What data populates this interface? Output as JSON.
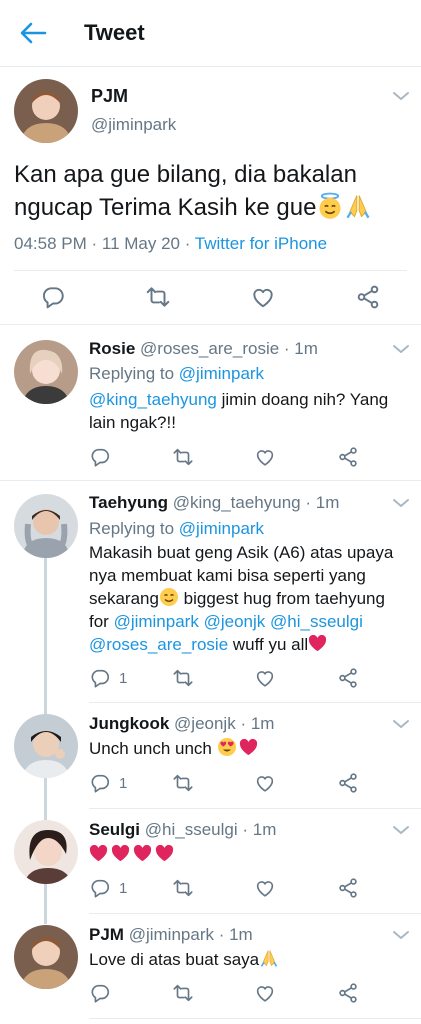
{
  "header": {
    "title": "Tweet"
  },
  "main": {
    "name": "PJM",
    "handle": "@jiminpark",
    "text": "Kan apa gue bilang, dia bakalan ngucap Terima Kasih ke gue",
    "time": "04:58 PM · 11 May 20 · ",
    "source": "Twitter for iPhone"
  },
  "replies": [
    {
      "name": "Rosie",
      "handle": "@roses_are_rosie",
      "time": "· 1m",
      "replying_label": "Replying to ",
      "replying_to": "@jiminpark",
      "mention": "@king_taehyung",
      "text": " jimin doang nih? Yang lain ngak?!!",
      "reply_count": ""
    },
    {
      "name": "Taehyung",
      "handle": "@king_taehyung",
      "time": "· 1m",
      "replying_label": "Replying to ",
      "replying_to": "@jiminpark",
      "text_a": "Makasih buat geng Asik (A6) atas upaya nya membuat kami bisa seperti yang sekarang",
      "text_b": " biggest hug from taehyung for ",
      "m1": "@jiminpark",
      "m2": "@jeonjk",
      "m3": "@hi_sseulgi",
      "m4": "@roses_are_rosie",
      "text_c": " wuff yu all",
      "reply_count": "1"
    },
    {
      "name": "Jungkook",
      "handle": "@jeonjk",
      "time": "· 1m",
      "text": "Unch unch unch ",
      "reply_count": "1"
    },
    {
      "name": "Seulgi",
      "handle": "@hi_sseulgi",
      "time": "· 1m",
      "reply_count": "1"
    },
    {
      "name": "PJM",
      "handle": "@jiminpark",
      "time": "· 1m",
      "text": "Love di atas buat saya",
      "reply_count": ""
    }
  ],
  "colors": {
    "accent": "#1b95e0",
    "heart": "#e0245e",
    "text": "#14171a",
    "muted": "#657786"
  },
  "icons": [
    "back-arrow-icon",
    "chevron-down-icon",
    "reply-icon",
    "retweet-icon",
    "like-icon",
    "share-icon",
    "halo-smile-emoji",
    "folded-hands-emoji",
    "smiling-face-emoji",
    "heart-eyes-emoji",
    "heart-emoji"
  ]
}
